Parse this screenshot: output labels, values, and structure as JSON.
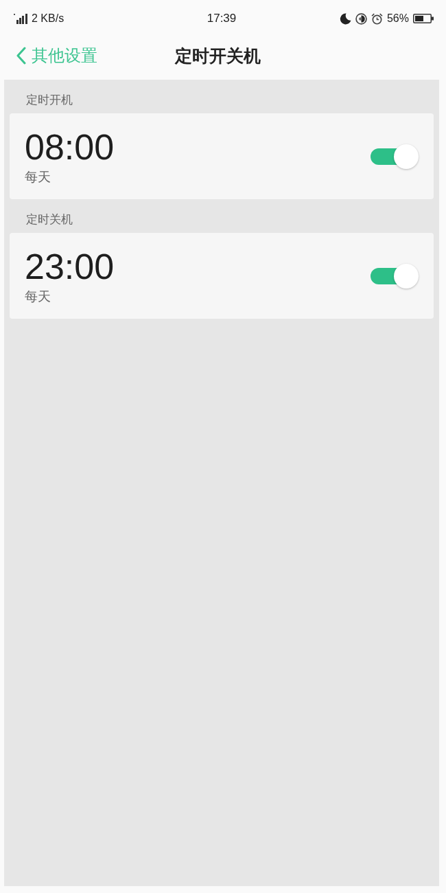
{
  "status_bar": {
    "network_speed": "2 KB/s",
    "time": "17:39",
    "battery": "56%"
  },
  "nav_bar": {
    "back_label": "其他设置",
    "title": "定时开关机"
  },
  "sections": [
    {
      "header": "定时开机",
      "schedules": [
        {
          "time": "08:00",
          "repeat": "每天",
          "on": true
        }
      ]
    },
    {
      "header": "定时关机",
      "schedules": [
        {
          "time": "23:00",
          "repeat": "每天",
          "on": true
        }
      ]
    }
  ]
}
